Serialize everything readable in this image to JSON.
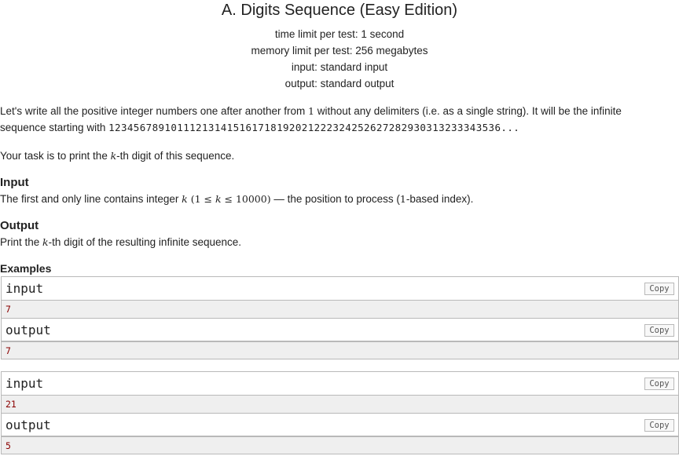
{
  "problem": {
    "title": "A. Digits Sequence (Easy Edition)",
    "time_limit": "time limit per test: 1 second",
    "memory_limit": "memory limit per test: 256 megabytes",
    "input_spec": "input: standard input",
    "output_spec": "output: standard output"
  },
  "statement": {
    "p1_a": "Let's write all the positive integer numbers one after another from ",
    "p1_one": "1",
    "p1_b": " without any delimiters (i.e. as a single string). It will be the infinite",
    "p1_c": "sequence starting with ",
    "sequence": "123456789101112131415161718192021222324252627282930313233343536...",
    "p2_a": "Your task is to print the ",
    "k": "k",
    "p2_b": "-th digit of this sequence."
  },
  "input_section": {
    "heading": "Input",
    "text_a": "The first and only line contains integer ",
    "k": "k",
    "constraint": " (1 ≤ ",
    "k2": "k",
    "constraint_b": " ≤ 10000)",
    "text_b": " — the position to process (",
    "one": "1",
    "text_c": "-based index)."
  },
  "output_section": {
    "heading": "Output",
    "text_a": "Print the ",
    "k": "k",
    "text_b": "-th digit of the resulting infinite sequence."
  },
  "examples": {
    "heading": "Examples",
    "copy_label": "Copy",
    "input_label": "input",
    "output_label": "output",
    "cases": [
      {
        "input": "7",
        "output": "7"
      },
      {
        "input": "21",
        "output": "5"
      }
    ]
  }
}
